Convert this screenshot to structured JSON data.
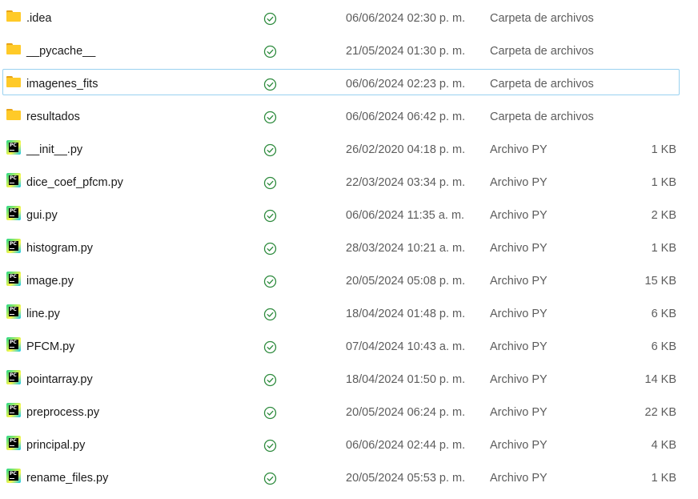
{
  "colors": {
    "folder_back": "#e8a317",
    "folder_body": "#ffca28",
    "sync_green": "#2e8b3e",
    "hover_border": "#99d1f0",
    "secondary_text": "#5c5c5c"
  },
  "icons": {
    "folder": "folder-icon",
    "python_file": "pycharm-file-icon",
    "status": "sync-check-icon"
  },
  "files": [
    {
      "name": ".idea",
      "kind": "folder",
      "date": "06/06/2024 02:30 p. m.",
      "type": "Carpeta de archivos",
      "size": ""
    },
    {
      "name": "__pycache__",
      "kind": "folder",
      "date": "21/05/2024 01:30 p. m.",
      "type": "Carpeta de archivos",
      "size": ""
    },
    {
      "name": "imagenes_fits",
      "kind": "folder",
      "date": "06/06/2024 02:23 p. m.",
      "type": "Carpeta de archivos",
      "size": "",
      "hovered": true
    },
    {
      "name": "resultados",
      "kind": "folder",
      "date": "06/06/2024 06:42 p. m.",
      "type": "Carpeta de archivos",
      "size": ""
    },
    {
      "name": "__init__.py",
      "kind": "py",
      "date": "26/02/2020 04:18 p. m.",
      "type": "Archivo PY",
      "size": "1 KB"
    },
    {
      "name": "dice_coef_pfcm.py",
      "kind": "py",
      "date": "22/03/2024 03:34 p. m.",
      "type": "Archivo PY",
      "size": "1 KB"
    },
    {
      "name": "gui.py",
      "kind": "py",
      "date": "06/06/2024 11:35 a. m.",
      "type": "Archivo PY",
      "size": "2 KB"
    },
    {
      "name": "histogram.py",
      "kind": "py",
      "date": "28/03/2024 10:21 a. m.",
      "type": "Archivo PY",
      "size": "1 KB"
    },
    {
      "name": "image.py",
      "kind": "py",
      "date": "20/05/2024 05:08 p. m.",
      "type": "Archivo PY",
      "size": "15 KB"
    },
    {
      "name": "line.py",
      "kind": "py",
      "date": "18/04/2024 01:48 p. m.",
      "type": "Archivo PY",
      "size": "6 KB"
    },
    {
      "name": "PFCM.py",
      "kind": "py",
      "date": "07/04/2024 10:43 a. m.",
      "type": "Archivo PY",
      "size": "6 KB"
    },
    {
      "name": "pointarray.py",
      "kind": "py",
      "date": "18/04/2024 01:50 p. m.",
      "type": "Archivo PY",
      "size": "14 KB"
    },
    {
      "name": "preprocess.py",
      "kind": "py",
      "date": "20/05/2024 06:24 p. m.",
      "type": "Archivo PY",
      "size": "22 KB"
    },
    {
      "name": "principal.py",
      "kind": "py",
      "date": "06/06/2024 02:44 p. m.",
      "type": "Archivo PY",
      "size": "4 KB"
    },
    {
      "name": "rename_files.py",
      "kind": "py",
      "date": "20/05/2024 05:53 p. m.",
      "type": "Archivo PY",
      "size": "1 KB"
    }
  ]
}
